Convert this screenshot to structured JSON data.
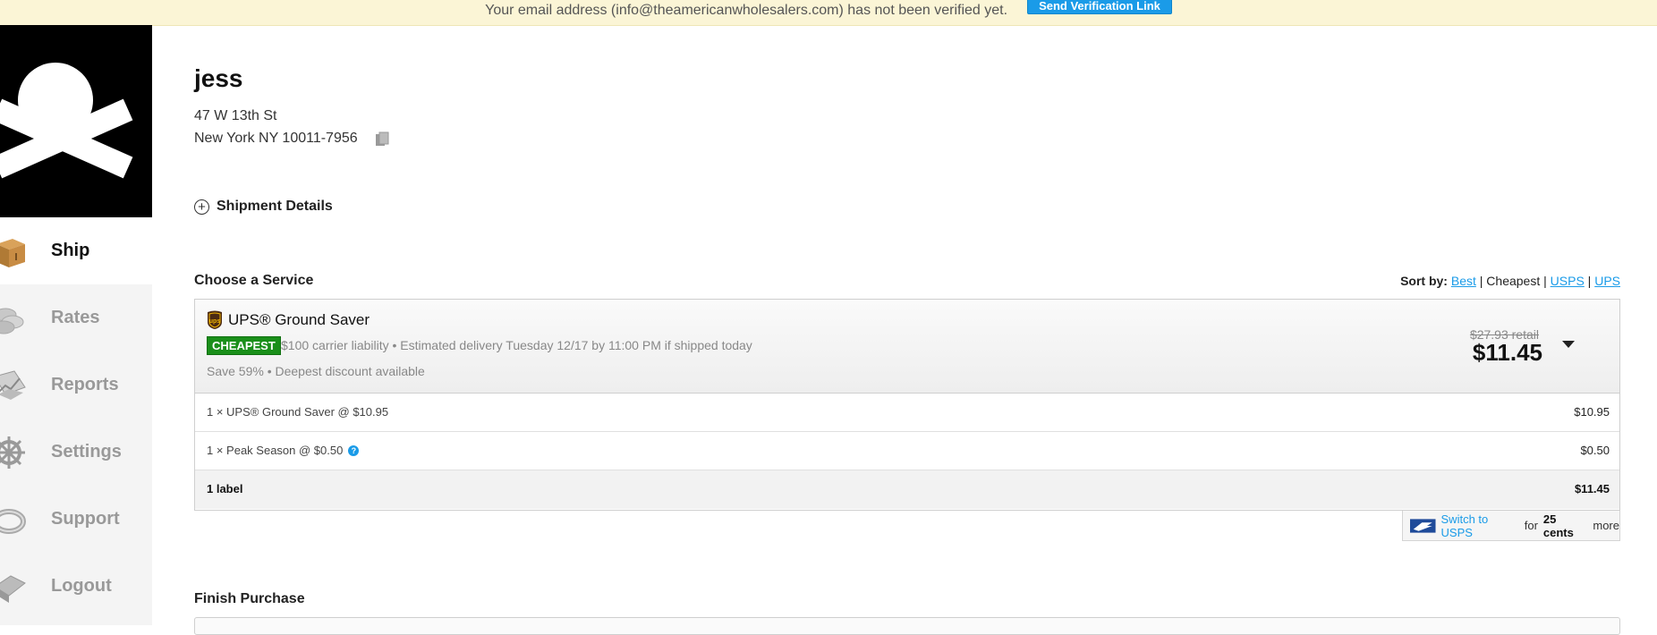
{
  "banner": {
    "message": "Your email address (info@theamericanwholesalers.com) has not been verified yet.",
    "button_label": "Send Verification Link"
  },
  "sidebar": {
    "items": [
      {
        "label": "Ship",
        "icon": "box-icon",
        "active": true
      },
      {
        "label": "Rates",
        "icon": "coins-icon",
        "active": false
      },
      {
        "label": "Reports",
        "icon": "reports-icon",
        "active": false
      },
      {
        "label": "Settings",
        "icon": "ship-wheel-icon",
        "active": false
      },
      {
        "label": "Support",
        "icon": "lifebuoy-icon",
        "active": false
      },
      {
        "label": "Logout",
        "icon": "logout-icon",
        "active": false
      }
    ]
  },
  "recipient": {
    "name": "jess",
    "address_line1": "47 W 13th St",
    "address_line2": "New York NY 10011-7956"
  },
  "shipment_details": {
    "label": "Shipment Details"
  },
  "choose_service": {
    "title": "Choose a Service",
    "sort": {
      "label": "Sort by:",
      "options": [
        "Best",
        "Cheapest",
        "USPS",
        "UPS"
      ],
      "selected": "Cheapest"
    },
    "selected_service": {
      "name": "UPS® Ground Saver",
      "badge": "CHEAPEST",
      "description": "$100 carrier liability • Estimated delivery Tuesday 12/17 by 11:00 PM if shipped today",
      "savings": "Save 59% • Deepest discount available",
      "retail": "$27.93 retail",
      "price": "$11.45"
    },
    "line_items": [
      {
        "label": "1 × UPS® Ground Saver @ $10.95",
        "amount": "$10.95"
      },
      {
        "label": "1 × Peak Season @ $0.50",
        "amount": "$0.50",
        "help": "?"
      }
    ],
    "total": {
      "label": "1 label",
      "amount": "$11.45"
    },
    "switch": {
      "link": "Switch to USPS",
      "for": "for",
      "amount": "25 cents",
      "more": "more"
    }
  },
  "finish_purchase": {
    "title": "Finish Purchase"
  },
  "colors": {
    "accent": "#1a9be8",
    "badge": "#1a8f1a",
    "banner_bg": "#fbf5d6"
  }
}
